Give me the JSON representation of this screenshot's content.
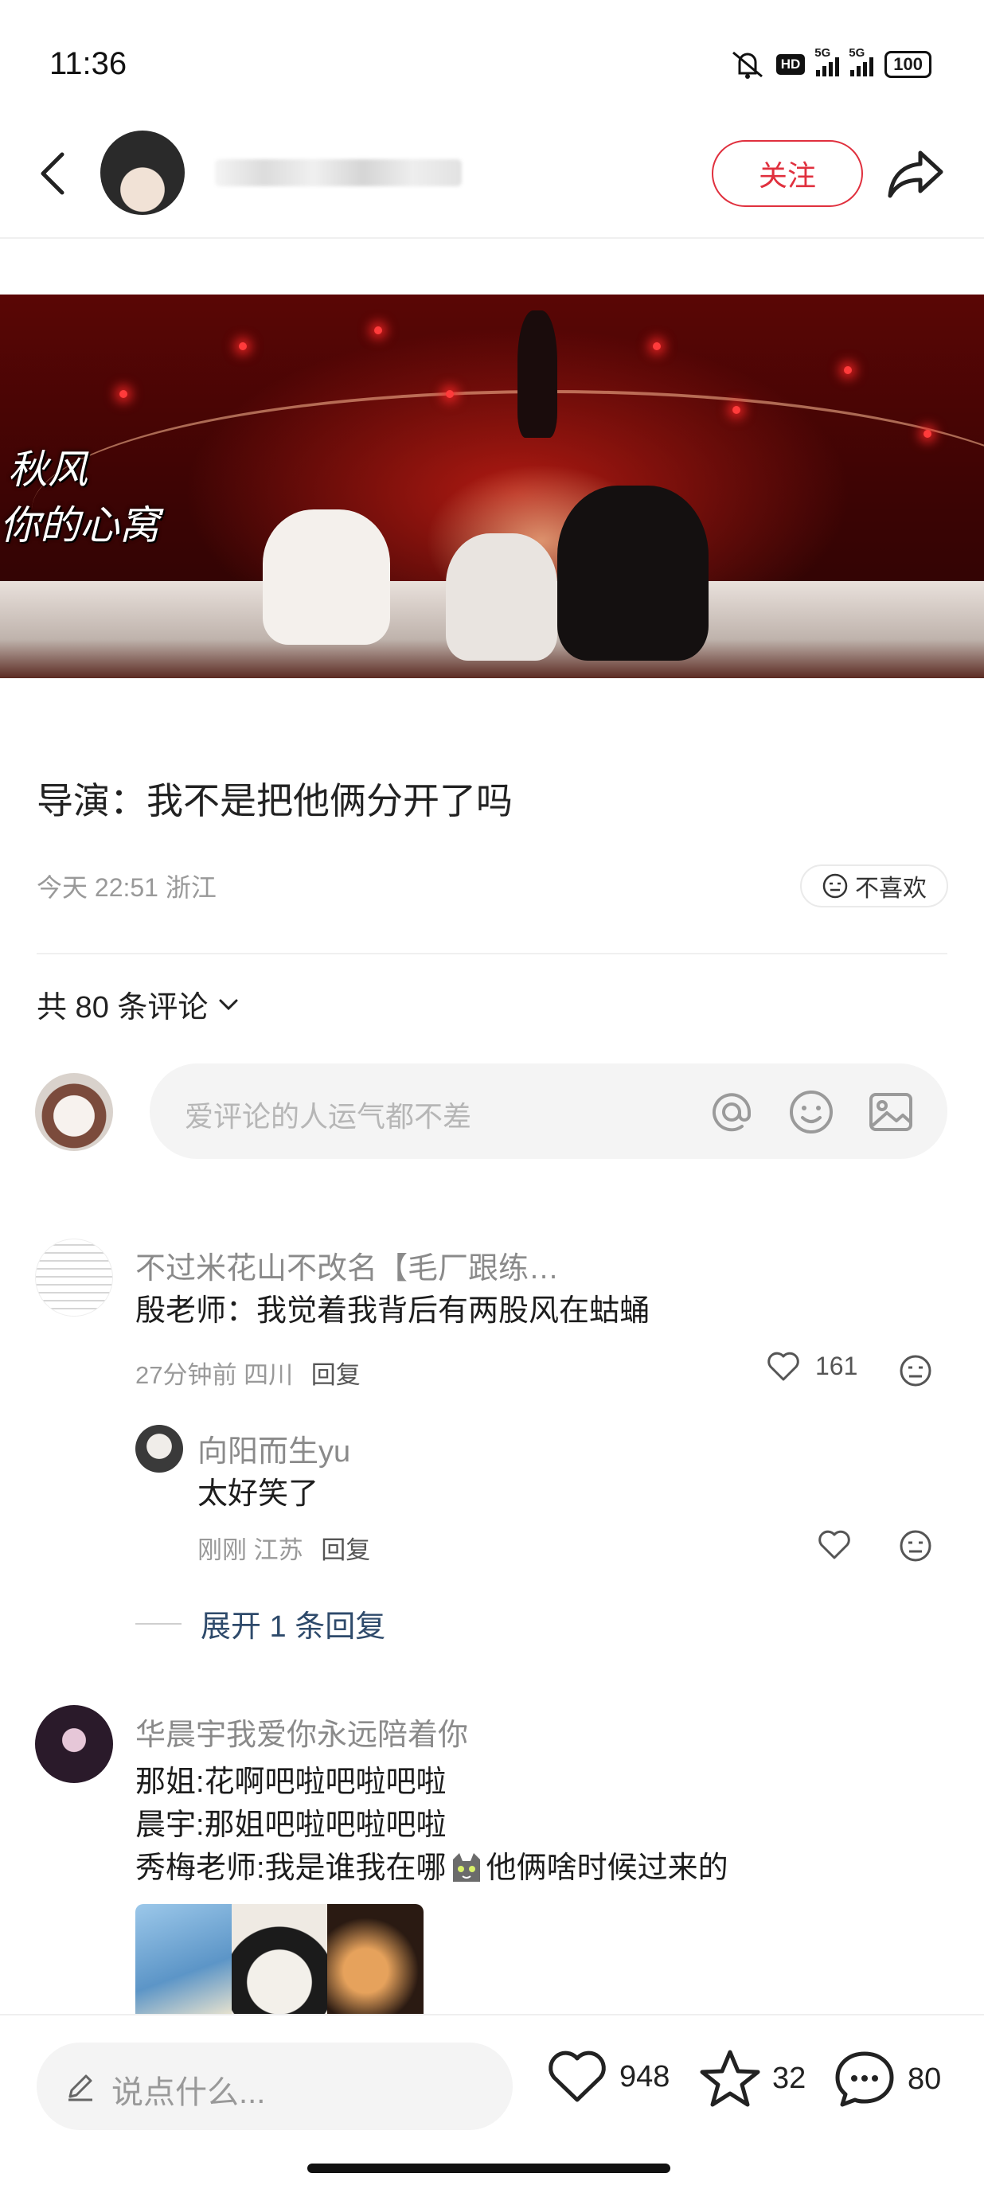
{
  "status_bar": {
    "time": "11:36",
    "hd": "HD",
    "net1": "5G",
    "net2": "5G",
    "battery": "100"
  },
  "header": {
    "follow_label": "关注"
  },
  "hero": {
    "caption_line1": "秋风",
    "caption_line2": "你的心窝"
  },
  "post": {
    "title": "导演：我不是把他俩分开了吗",
    "meta": "今天 22:51 浙江",
    "dislike_label": "不喜欢"
  },
  "comments_section": {
    "count_label": "共 80 条评论",
    "input_placeholder": "爱评论的人运气都不差",
    "comments": [
      {
        "author": "不过米花山不改名【毛厂跟练…",
        "text": "殷老师：我觉着我背后有两股风在蛄蛹",
        "time": "27分钟前",
        "location": "四川",
        "reply_label": "回复",
        "likes": "161"
      },
      {
        "author": "华晨宇我爱你永远陪着你",
        "lines": [
          "那姐:花啊吧啦吧啦吧啦",
          "晨宇:那姐吧啦吧啦吧啦",
          "秀梅老师:我是谁我在哪",
          "他俩啥时候过来的"
        ]
      }
    ],
    "reply": {
      "author": "向阳而生yu",
      "text": "太好笑了",
      "time": "刚刚",
      "location": "江苏",
      "reply_label": "回复"
    },
    "expand_label": "展开 1 条回复"
  },
  "bottom_bar": {
    "input_placeholder": "说点什么...",
    "likes": "948",
    "stars": "32",
    "comments": "80"
  },
  "colors": {
    "accent": "#e0303e",
    "link": "#2e4a6b",
    "muted": "#999999"
  }
}
